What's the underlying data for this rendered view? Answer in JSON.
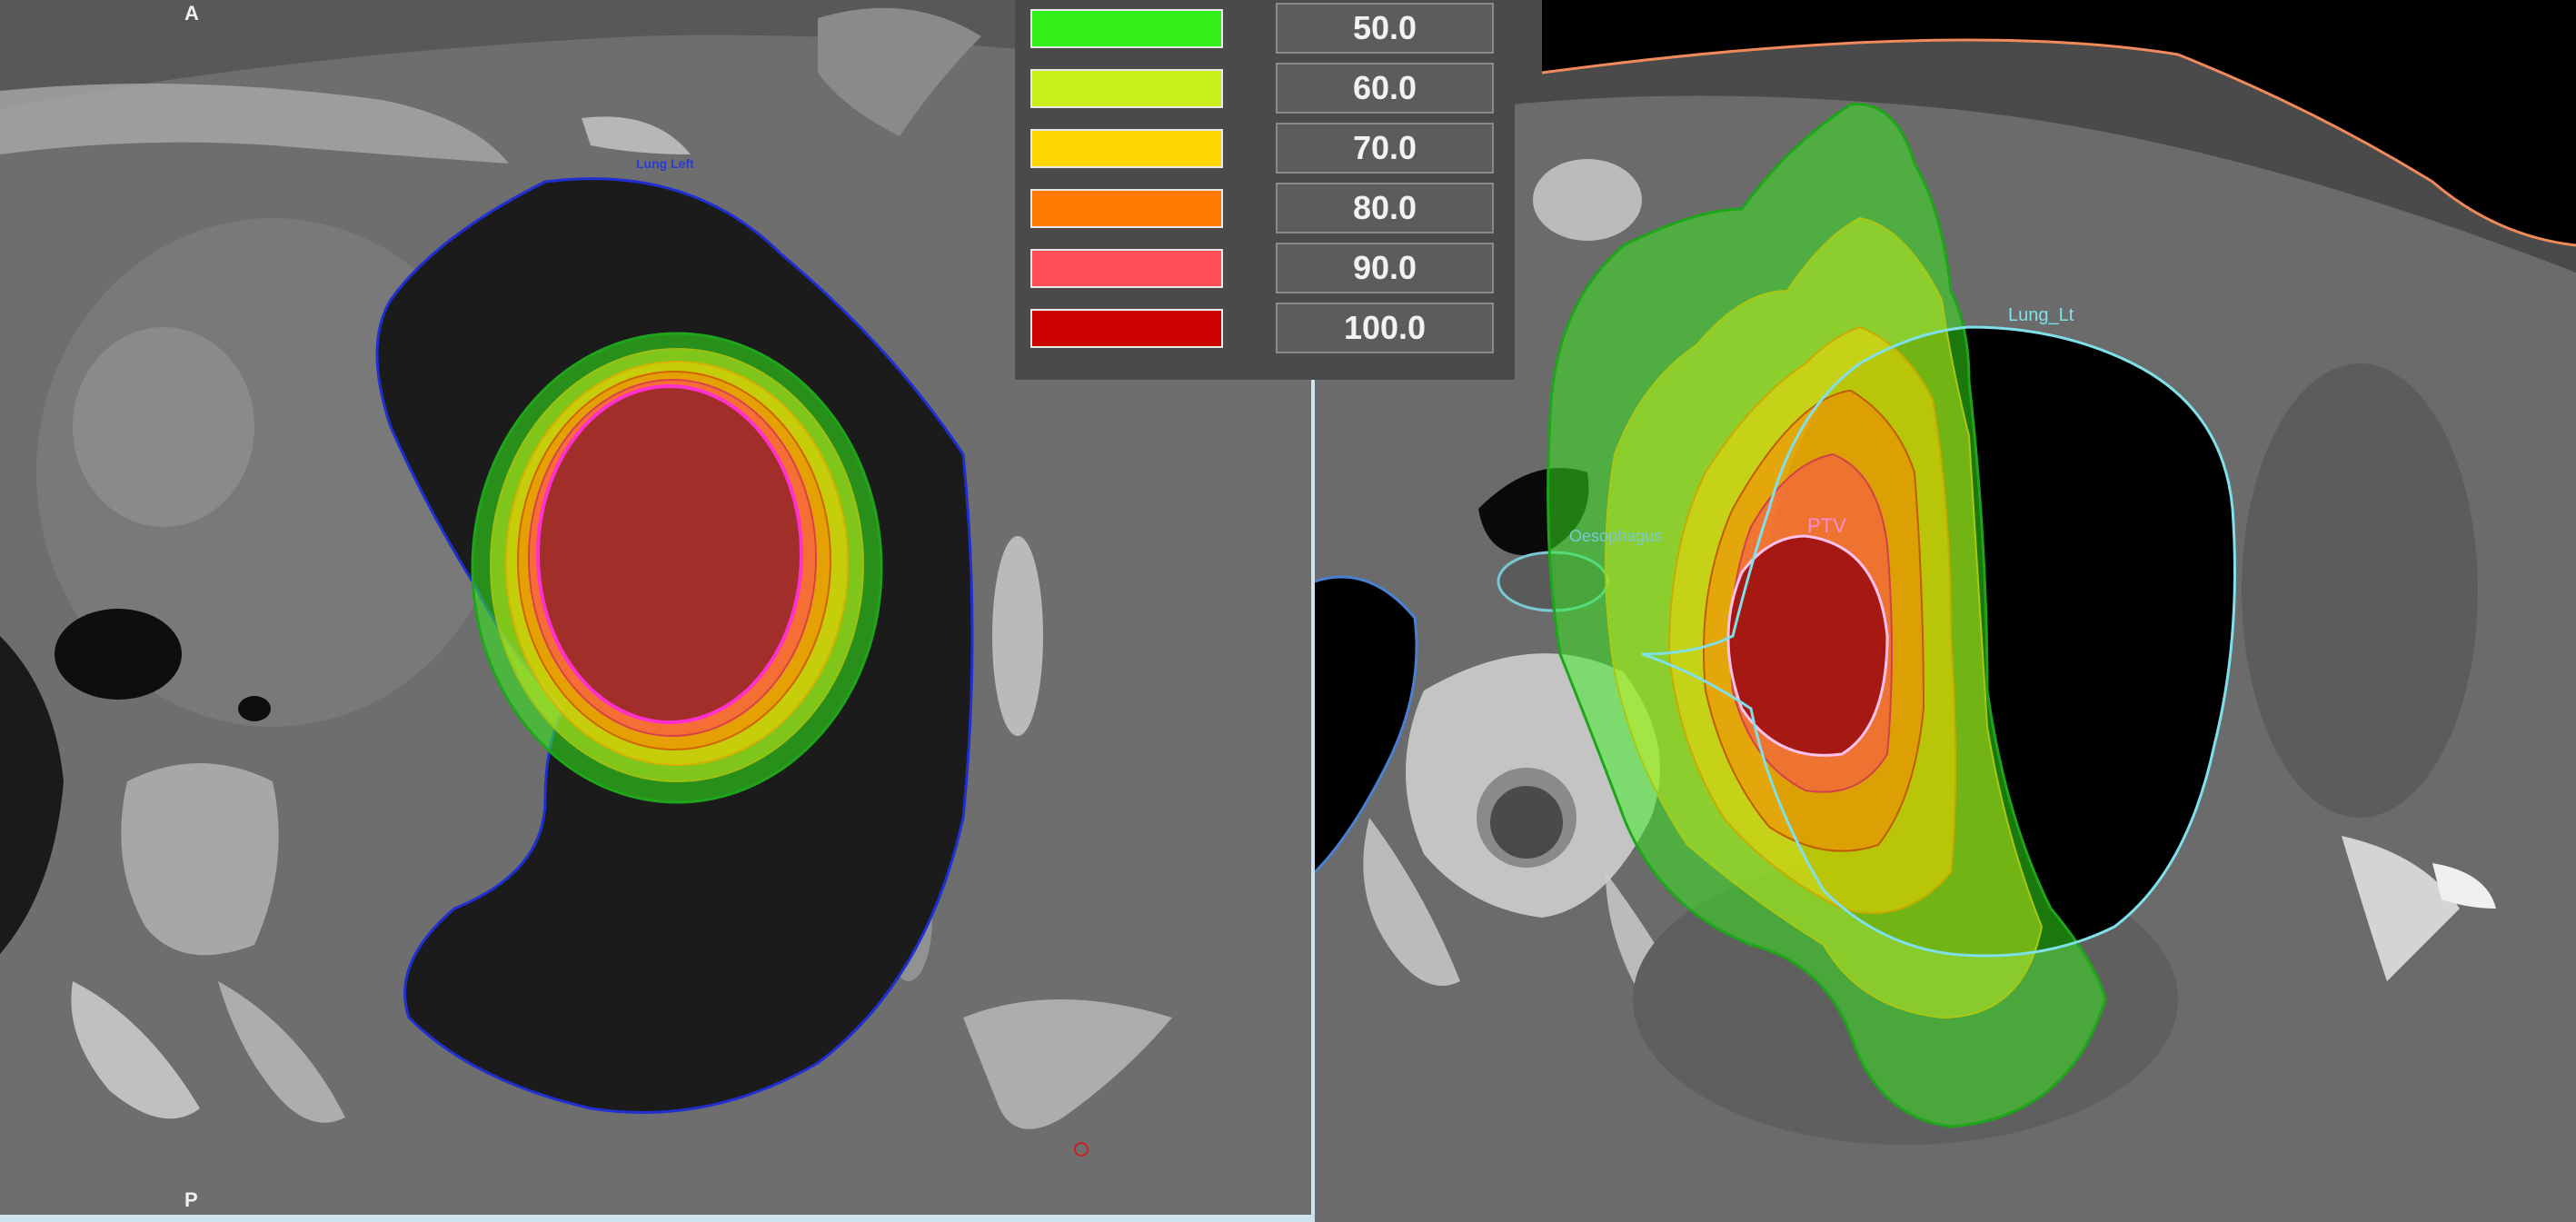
{
  "left_view": {
    "orientation_top": "A",
    "orientation_bottom": "P",
    "structure_label": "Lung Left"
  },
  "right_view": {
    "lung_label": "Lung_Lt",
    "esophagus_label": "Oesophagus",
    "target_label": "PTV"
  },
  "isodose_legend": {
    "items": [
      {
        "value": "50.0",
        "color": "#33f01a"
      },
      {
        "value": "60.0",
        "color": "#c9f01a"
      },
      {
        "value": "70.0",
        "color": "#ffd600"
      },
      {
        "value": "80.0",
        "color": "#ff7a00"
      },
      {
        "value": "90.0",
        "color": "#ff4f55"
      },
      {
        "value": "100.0",
        "color": "#cc0000"
      }
    ]
  },
  "colors": {
    "lung_left_contour": "#1f2fd4",
    "ptv_contour": "#ff2fd0",
    "lung_lt_contour": "#7fe0ea",
    "body_contour": "#f08a5a"
  }
}
